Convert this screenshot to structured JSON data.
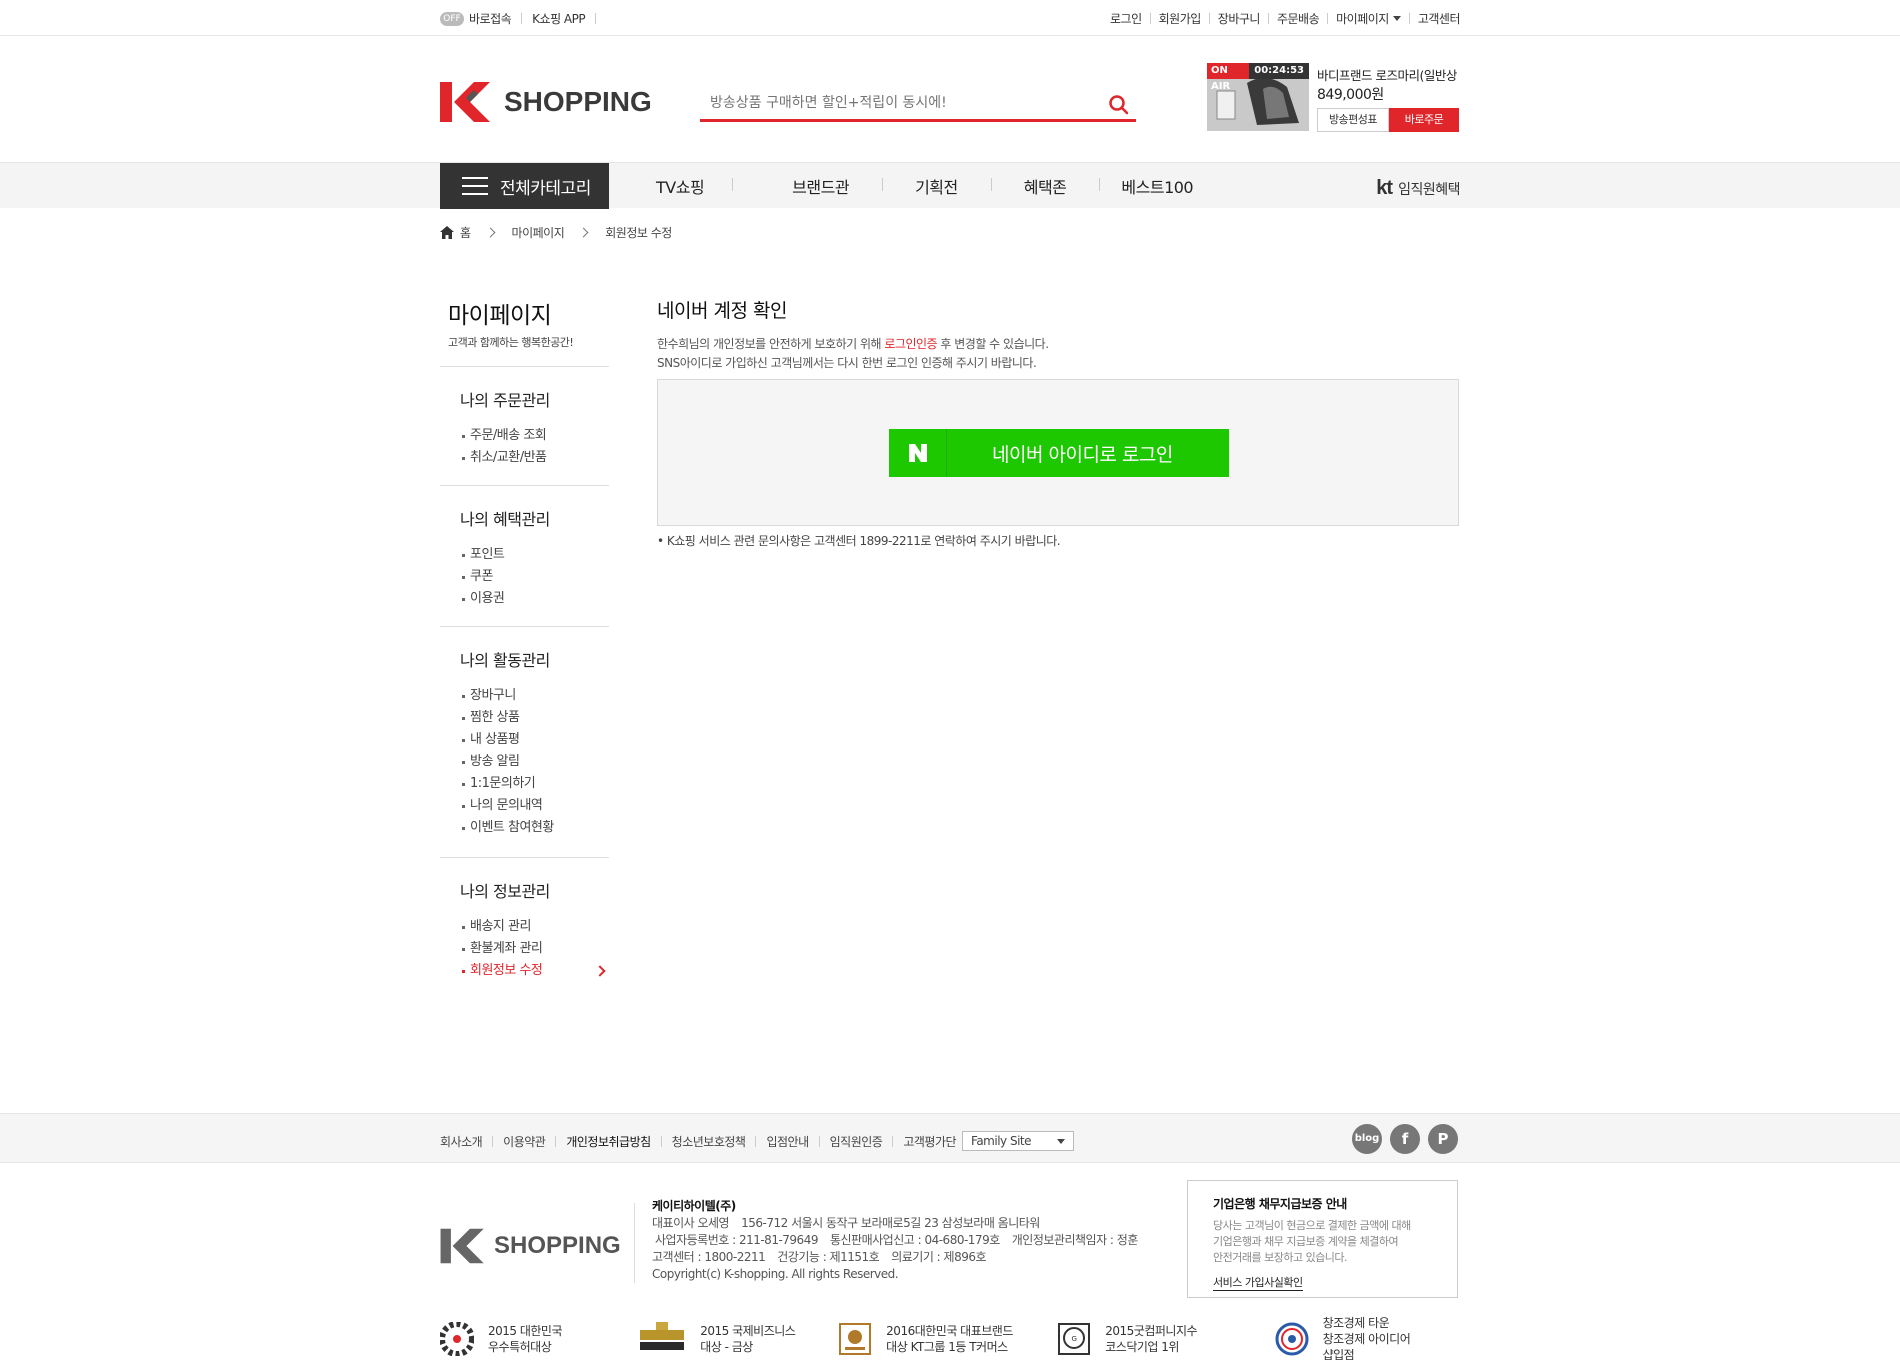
{
  "util": {
    "toggle": "OFF",
    "direct_access": "바로접속",
    "app": "K쇼핑 APP",
    "links": [
      "로그인",
      "회원가입",
      "장바구니",
      "주문배송",
      "마이페이지",
      "고객센터"
    ]
  },
  "header": {
    "logo_text": "SHOPPING",
    "search_placeholder": "방송상품 구매하면 할인+적립이 동시에!",
    "onair": {
      "label": "ON AIR",
      "time": "00:24:53",
      "title": "바디프랜드 로즈마리(일반상...",
      "price": "849,000원",
      "schedule_btn": "방송편성표",
      "buy_btn": "바로주문"
    }
  },
  "gnb": {
    "all_category": "전체카테고리",
    "items": [
      "TV쇼핑",
      "브랜드관",
      "기획전",
      "혜택존",
      "베스트100"
    ],
    "kt_logo": "kt",
    "kt_label": "임직원혜택"
  },
  "breadcrumb": [
    "홈",
    "마이페이지",
    "회원정보 수정"
  ],
  "side": {
    "title": "마이페이지",
    "subtitle": "고객과 함께하는 행복한공간!",
    "groups": [
      {
        "title": "나의 주문관리",
        "items": [
          "주문/배송 조회",
          "취소/교환/반품"
        ]
      },
      {
        "title": "나의 혜택관리",
        "items": [
          "포인트",
          "쿠폰",
          "이용권"
        ]
      },
      {
        "title": "나의 활동관리",
        "items": [
          "장바구니",
          "찜한 상품",
          "내 상품평",
          "방송 알림",
          "1:1문의하기",
          "나의 문의내역",
          "이벤트 참여현황"
        ]
      },
      {
        "title": "나의 정보관리",
        "items": [
          "배송지 관리",
          "환불계좌 관리",
          "회원정보 수정"
        ]
      }
    ]
  },
  "main": {
    "title": "네이버 계정 확인",
    "desc1_pre": "한수희님의 개인정보를 안전하게 보호하기 위해 ",
    "desc1_red": "로그인인증",
    "desc1_post": " 후 변경할 수 있습니다.",
    "desc2": "SNS아이디로 가입하신 고객님께서는 다시 한번 로그인 인증해 주시기 바랍니다.",
    "naver_btn": "네이버 아이디로 로그인",
    "note": "• K쇼핑 서비스 관련 문의사항은 고객센터 1899-2211로 연락하여 주시기 바랍니다."
  },
  "footer": {
    "links": [
      "회사소개",
      "이용약관",
      "개인정보취급방침",
      "청소년보호정책",
      "입점안내",
      "임직원인증",
      "고객평가단"
    ],
    "family_site": "Family Site",
    "sns": [
      "blog",
      "f",
      "P"
    ],
    "logo_text": "SHOPPING",
    "company": "케이티하이텔(주)",
    "line1": [
      "대표이사 오세영",
      "156-712 서울시 동작구 보라매로5길 23 삼성보라매 옴니타워"
    ],
    "line2": [
      "사업자등록번호 : 211-81-79649",
      "통신판매사업신고 : 04-680-179호",
      "개인정보관리책임자 : 정훈"
    ],
    "line3": [
      "고객센터 : 1800-2211",
      "건강기능 : 제1151호",
      "의료기기 : 제896호"
    ],
    "copyright": "Copyright(c) K-shopping. All rights Reserved.",
    "guarantee": {
      "title": "기업은행 채무지급보증 안내",
      "text1": "당사는 고객님이 현금으로 결제한 금액에 대해",
      "text2": "기업은행과 채무 지급보증 계약을 체결하여",
      "text3": "안전거래를 보장하고 있습니다.",
      "link": "서비스 가입사실확인"
    },
    "awards": [
      {
        "line1": "2015 대한민국",
        "line2": "우수특허대상"
      },
      {
        "line1": "2015 국제비즈니스",
        "line2": "대상 - 금상"
      },
      {
        "line1": "2016대한민국 대표브랜드",
        "line2": "대상 KT그룹 1등 T커머스"
      },
      {
        "line1": "2015굿컴퍼니지수",
        "line2": "코스닥기업 1위"
      },
      {
        "line1": "창조경제 타운",
        "line2": "창조경제 아이디어샵입점"
      }
    ]
  },
  "colors": {
    "accent": "#e0262b",
    "naver": "#1ec800",
    "dark": "#333333"
  }
}
